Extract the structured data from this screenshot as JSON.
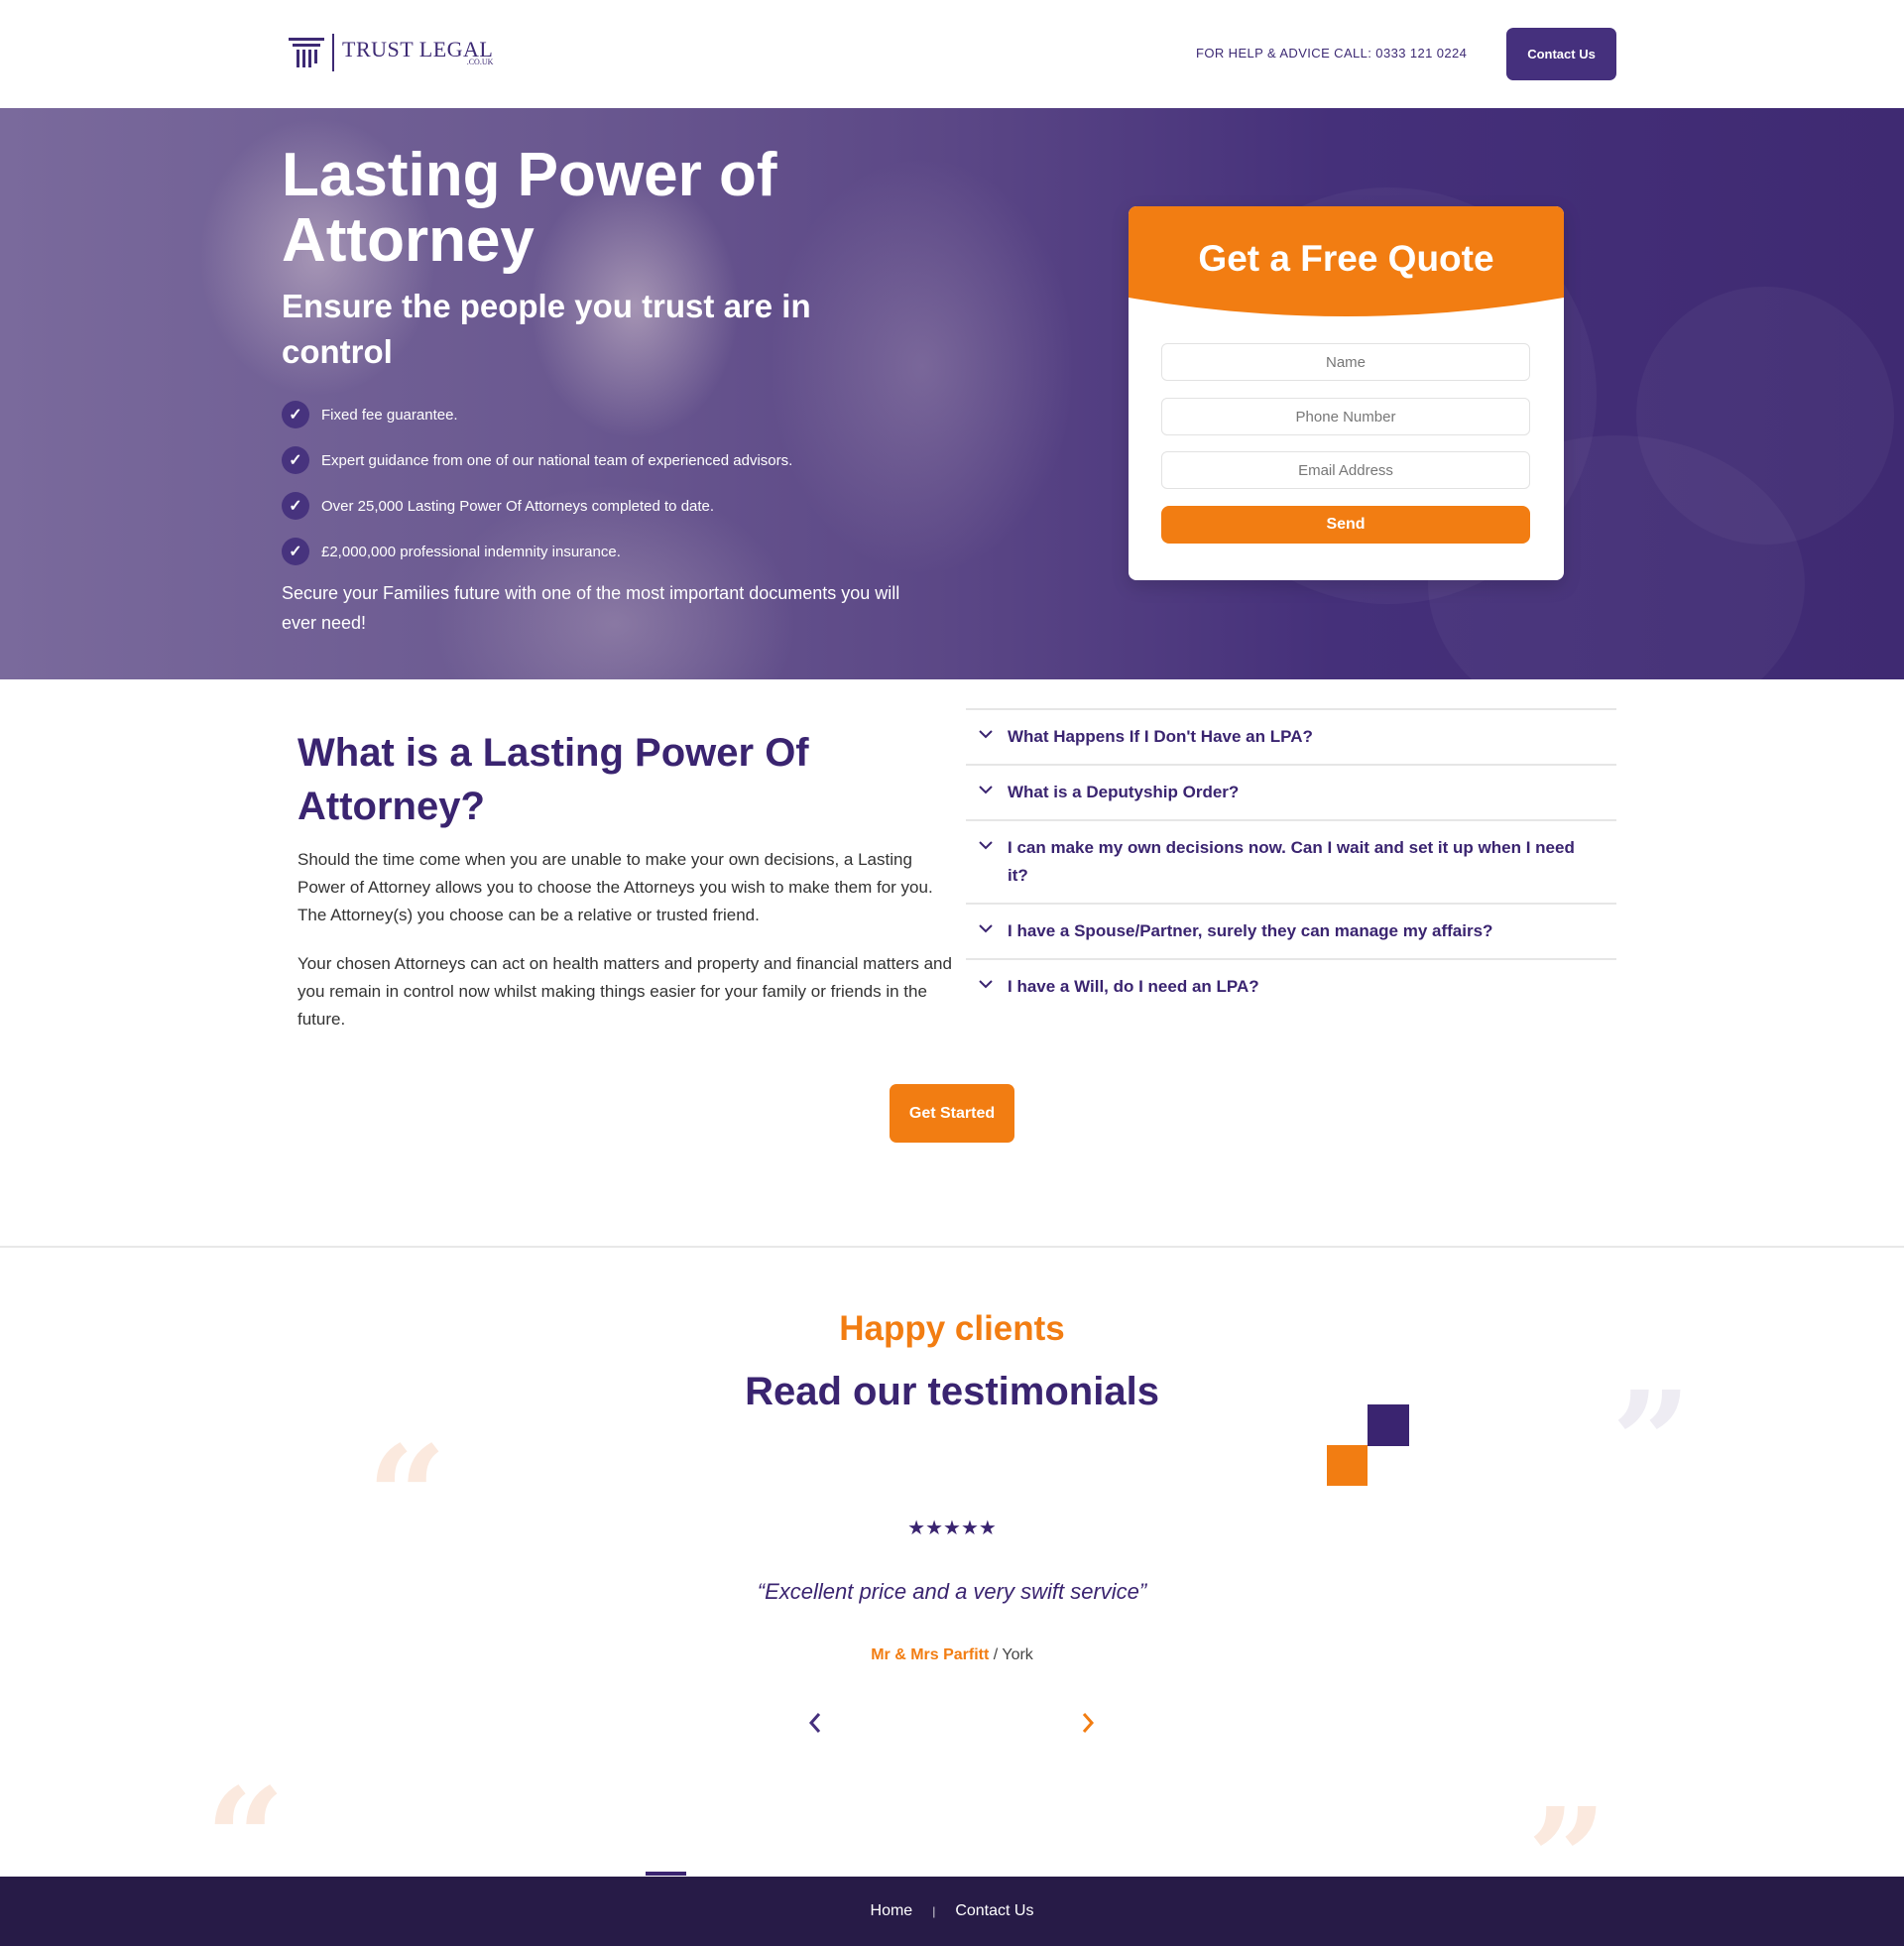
{
  "header": {
    "logo_text": "TRUST LEGAL",
    "logo_sub": ".CO.UK",
    "help_text": "FOR HELP & ADVICE CALL: 0333 121 0224",
    "contact_label": "Contact Us"
  },
  "hero": {
    "title": "Lasting Power of Attorney",
    "subtitle": "Ensure the people you trust are in control",
    "features": [
      "Fixed fee guarantee.",
      "Expert guidance from one of our national team of experienced advisors.",
      "Over 25,000 Lasting Power Of Attorneys completed to date.",
      "£2,000,000 professional indemnity insurance."
    ],
    "note": "Secure your Families future with one of the most important documents you will ever need!"
  },
  "quote_form": {
    "title": "Get a Free Quote",
    "name_placeholder": "Name",
    "phone_placeholder": "Phone Number",
    "email_placeholder": "Email Address",
    "send_label": "Send"
  },
  "lpa": {
    "title": "What is a Lasting Power Of Attorney?",
    "paragraphs": [
      "Should the time come when you are unable to make your own decisions, a Lasting Power of Attorney allows you to choose the Attorneys you wish to make them for you. The Attorney(s) you choose can be a relative or trusted friend.",
      "Your chosen Attorneys can act on health matters and property and financial matters and you remain in control now whilst making things easier for your family or friends in the future."
    ],
    "faq": [
      "What Happens If I Don't Have an LPA?",
      "What is a Deputyship Order?",
      "I can make my own decisions now. Can I wait and set it up when I need it?",
      "I have a Spouse/Partner, surely they can manage my affairs?",
      "I have a Will, do I need an LPA?"
    ],
    "cta_label": "Get Started"
  },
  "testimonials": {
    "kicker": "Happy clients",
    "title": "Read our testimonials",
    "stars": "★★★★★",
    "rating": 5,
    "quote": "“Excellent price and a very swift service”",
    "author_name": "Mr & Mrs Parfitt",
    "author_location": " / York",
    "prev_icon": "chevron-left-icon",
    "next_icon": "chevron-right-icon"
  },
  "footer": {
    "links": [
      "Home",
      "Contact Us"
    ],
    "separator": "|"
  },
  "colors": {
    "brand_purple": "#3a2470",
    "button_purple": "#45307d",
    "accent_orange": "#f27d12",
    "footer_bg": "#271b47"
  }
}
